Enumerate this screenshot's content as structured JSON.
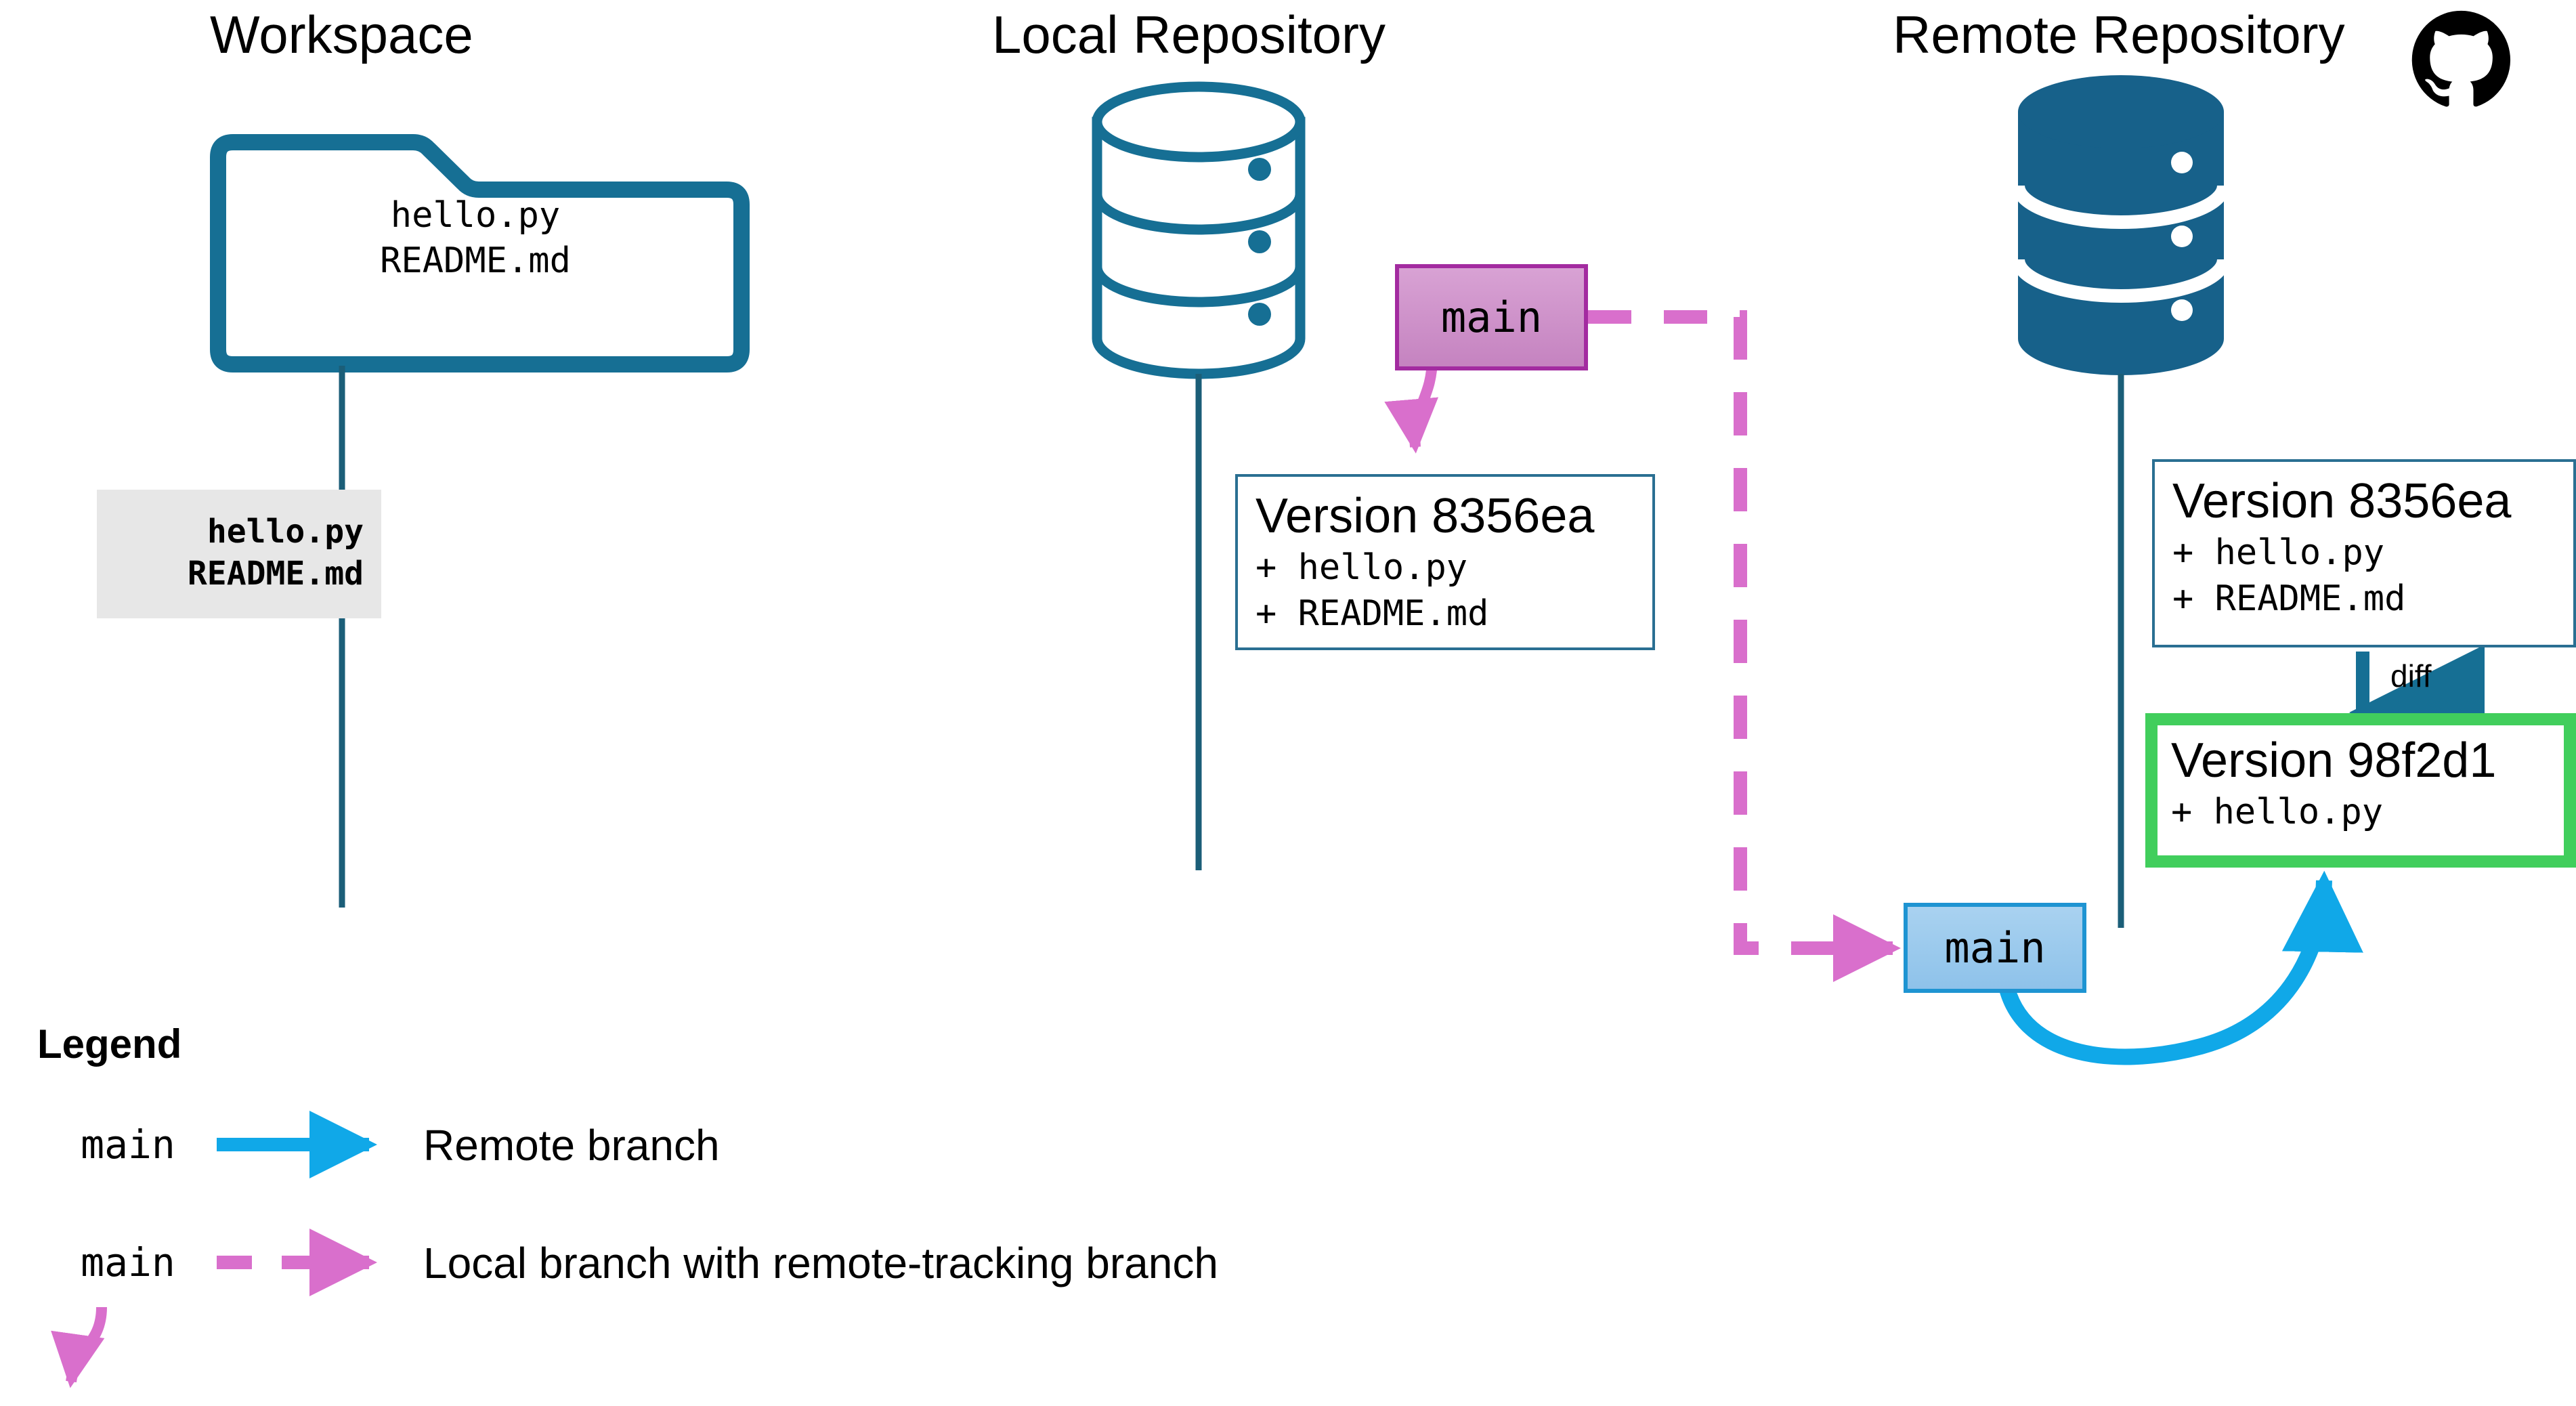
{
  "columns": {
    "workspace": {
      "title": "Workspace"
    },
    "local": {
      "title": "Local Repository"
    },
    "remote": {
      "title": "Remote Repository"
    }
  },
  "workspace": {
    "folder_files": "hello.py\nREADME.md",
    "staged_files": "hello.py\nREADME.md"
  },
  "local_repo": {
    "branch_badge": "main",
    "version": {
      "title": "Version 8356ea",
      "line1": "+ hello.py",
      "line2": "+ README.md"
    }
  },
  "remote_repo": {
    "logo": "github-octocat-icon",
    "branch_badge": "main",
    "version_old": {
      "title": "Version 8356ea",
      "line1": "+ hello.py",
      "line2": "+ README.md"
    },
    "version_new": {
      "title": "Version 98f2d1",
      "line1": "+ hello.py"
    },
    "diff_label": "diff"
  },
  "legend": {
    "heading": "Legend",
    "items": [
      {
        "badge": "main",
        "label": "Remote branch",
        "kind": "remote"
      },
      {
        "badge": "main",
        "label": "Local branch with remote-tracking branch",
        "kind": "local"
      }
    ]
  },
  "colors": {
    "teal": "#166f94",
    "teal_border": "#2a6f92",
    "green": "#41ce5c",
    "pink": "#d96fcc",
    "pink_border": "#a32ba0",
    "pink_fill": "#c583c0",
    "blue": "#10a8e8",
    "blue_border": "#1e94d2",
    "blue_fill": "#8ec2ea",
    "gray": "#e7e7e7",
    "black": "#000000"
  }
}
